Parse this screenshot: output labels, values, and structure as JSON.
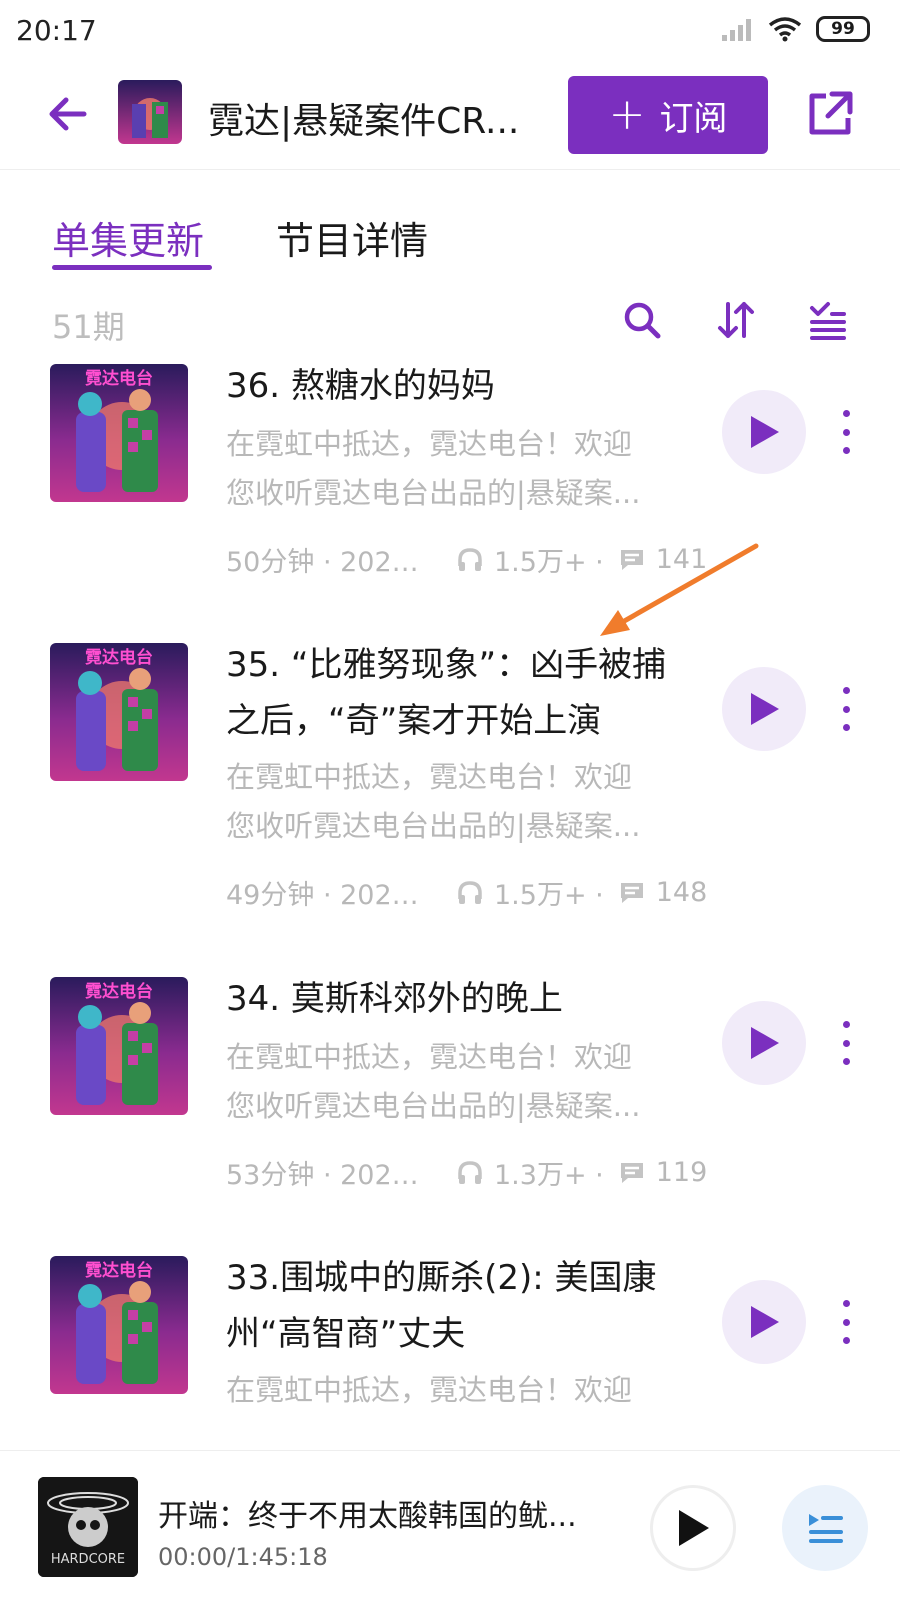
{
  "status_bar": {
    "time": "20:17",
    "battery": "99"
  },
  "header": {
    "title": "霓达|悬疑案件CR...",
    "subscribe_label": "订阅",
    "subscribe_plus": "+"
  },
  "tabs": [
    {
      "label": "单集更新",
      "active": true
    },
    {
      "label": "节目详情",
      "active": false
    }
  ],
  "toolbar": {
    "episode_count": "51期"
  },
  "episodes": [
    {
      "title_lines": [
        "36. 熬糖水的妈妈"
      ],
      "desc_lines": [
        "在霓虹中抵达，霓达电台！欢迎",
        "您收听霓达电台出品的|悬疑案..."
      ],
      "duration": "50分钟 · 2022...",
      "plays": "1.5万+ ·",
      "comments": "141"
    },
    {
      "title_lines": [
        "35. “比雅努现象”：凶手被捕",
        "之后，“奇”案才开始上演"
      ],
      "desc_lines": [
        "在霓虹中抵达，霓达电台！欢迎",
        "您收听霓达电台出品的|悬疑案..."
      ],
      "duration": "49分钟 · 2022...",
      "plays": "1.5万+ ·",
      "comments": "148"
    },
    {
      "title_lines": [
        "34. 莫斯科郊外的晚上"
      ],
      "desc_lines": [
        "在霓虹中抵达，霓达电台！欢迎",
        "您收听霓达电台出品的|悬疑案..."
      ],
      "duration": "53分钟 · 2022...",
      "plays": "1.3万+ ·",
      "comments": "119"
    },
    {
      "title_lines": [
        "33.围城中的厮杀(2): 美国康",
        "州“高智商”丈夫"
      ],
      "desc_lines": [
        "在霓虹中抵达，霓达电台！欢迎"
      ]
    }
  ],
  "cover_text": "霓达电台",
  "player": {
    "title": "开端：终于不用太酸韩国的鱿...",
    "time": "00:00/1:45:18",
    "cover_text": "HARDCORE"
  },
  "colors": {
    "accent": "#7b2fbf",
    "muted_text": "#b8b8b8",
    "play_bg": "#f1ebf9",
    "annotation_arrow": "#f07c2c"
  },
  "icons": {
    "back": "arrow-left-icon",
    "share": "share-external-icon",
    "search": "search-icon",
    "sort": "sort-icon",
    "filter": "filter-list-icon",
    "headphones": "headphones-icon",
    "comment": "comment-icon",
    "play": "play-icon",
    "more": "more-vertical-icon",
    "playlist": "playlist-icon"
  }
}
